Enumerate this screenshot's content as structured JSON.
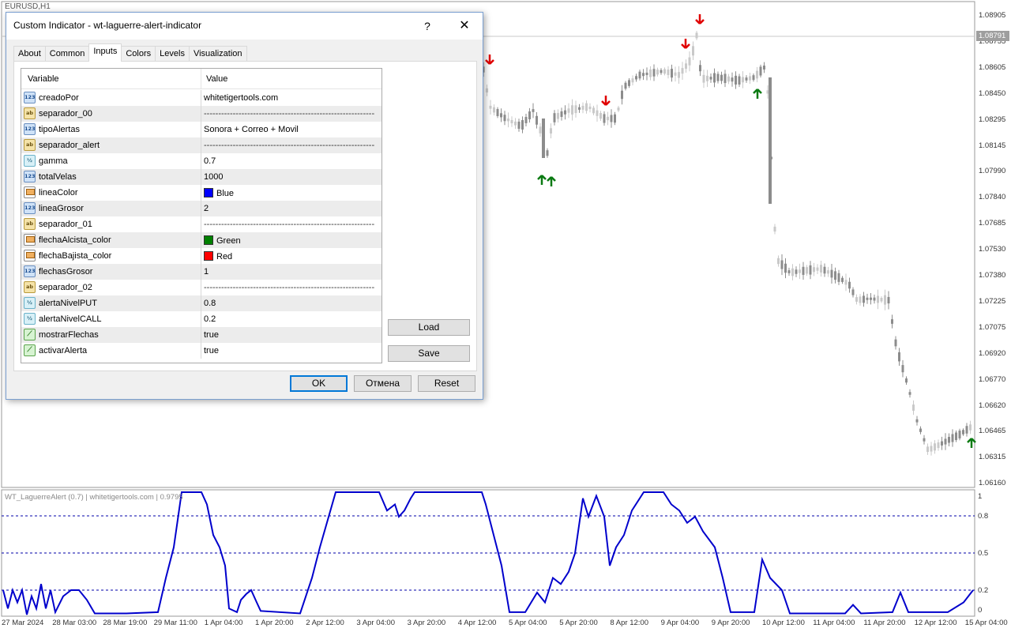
{
  "chart": {
    "symbol": "EURUSD,H1",
    "current_price": "1.08791",
    "price_ticks": [
      "1.08905",
      "1.08755",
      "1.08605",
      "1.08450",
      "1.08295",
      "1.08145",
      "1.07990",
      "1.07840",
      "1.07685",
      "1.07530",
      "1.07380",
      "1.07225",
      "1.07075",
      "1.06920",
      "1.06770",
      "1.06620",
      "1.06465",
      "1.06315",
      "1.06160"
    ],
    "indicator_label": "WT_LaguerreAlert (0.7) | whitetigertools.com | 0.9795",
    "indicator_ticks": [
      "1",
      "0.8",
      "0.5",
      "0.2",
      "0"
    ],
    "time_ticks": [
      "27 Mar 2024",
      "28 Mar 03:00",
      "28 Mar 19:00",
      "29 Mar 11:00",
      "1 Apr 04:00",
      "1 Apr 20:00",
      "2 Apr 12:00",
      "3 Apr 04:00",
      "3 Apr 20:00",
      "4 Apr 12:00",
      "5 Apr 04:00",
      "5 Apr 20:00",
      "8 Apr 12:00",
      "9 Apr 04:00",
      "9 Apr 20:00",
      "10 Apr 12:00",
      "11 Apr 04:00",
      "11 Apr 20:00",
      "12 Apr 12:00",
      "15 Apr 04:00"
    ],
    "colors": {
      "candle": "#8c8c8c",
      "up_arrow": "#0a7a12",
      "down_arrow": "#e00000",
      "indicator_line": "#0000cc",
      "level_line": "#0000aa"
    }
  },
  "dialog": {
    "title": "Custom Indicator - wt-laguerre-alert-indicator",
    "help": "?",
    "close": "✕",
    "tabs": [
      {
        "label": "About",
        "active": false
      },
      {
        "label": "Common",
        "active": false
      },
      {
        "label": "Inputs",
        "active": true
      },
      {
        "label": "Colors",
        "active": false
      },
      {
        "label": "Levels",
        "active": false
      },
      {
        "label": "Visualization",
        "active": false
      }
    ],
    "grid": {
      "col_variable": "Variable",
      "col_value": "Value",
      "rows": [
        {
          "icon": "int",
          "icon_text": "123",
          "name": "creadoPor",
          "value": "whitetigertools.com"
        },
        {
          "icon": "str",
          "icon_text": "ab",
          "name": "separador_00",
          "value": "------------------------------------------------------------------------------------------"
        },
        {
          "icon": "int",
          "icon_text": "123",
          "name": "tipoAlertas",
          "value": "Sonora + Correo + Movil"
        },
        {
          "icon": "str",
          "icon_text": "ab",
          "name": "separador_alert",
          "value": "------------------------------------------------------------------------------------------"
        },
        {
          "icon": "dbl",
          "icon_text": "½",
          "name": "gamma",
          "value": "0.7"
        },
        {
          "icon": "int",
          "icon_text": "123",
          "name": "totalVelas",
          "value": "1000"
        },
        {
          "icon": "clr",
          "icon_text": "",
          "name": "lineaColor",
          "value": "Blue",
          "swatch": "#0000ff"
        },
        {
          "icon": "int",
          "icon_text": "123",
          "name": "lineaGrosor",
          "value": "2"
        },
        {
          "icon": "str",
          "icon_text": "ab",
          "name": "separador_01",
          "value": "------------------------------------------------------------------------------------------"
        },
        {
          "icon": "clr",
          "icon_text": "",
          "name": "flechaAlcista_color",
          "value": "Green",
          "swatch": "#008000"
        },
        {
          "icon": "clr",
          "icon_text": "",
          "name": "flechaBajista_color",
          "value": "Red",
          "swatch": "#ff0000"
        },
        {
          "icon": "int",
          "icon_text": "123",
          "name": "flechasGrosor",
          "value": "1"
        },
        {
          "icon": "str",
          "icon_text": "ab",
          "name": "separador_02",
          "value": "------------------------------------------------------------------------------------------"
        },
        {
          "icon": "dbl",
          "icon_text": "½",
          "name": "alertaNivelPUT",
          "value": "0.8"
        },
        {
          "icon": "dbl",
          "icon_text": "½",
          "name": "alertaNivelCALL",
          "value": "0.2"
        },
        {
          "icon": "bool",
          "icon_text": "⟋",
          "name": "mostrarFlechas",
          "value": "true"
        },
        {
          "icon": "bool",
          "icon_text": "⟋",
          "name": "activarAlerta",
          "value": "true"
        }
      ]
    },
    "buttons": {
      "load": "Load",
      "save": "Save",
      "ok": "OK",
      "cancel": "Отмена",
      "reset": "Reset"
    }
  }
}
